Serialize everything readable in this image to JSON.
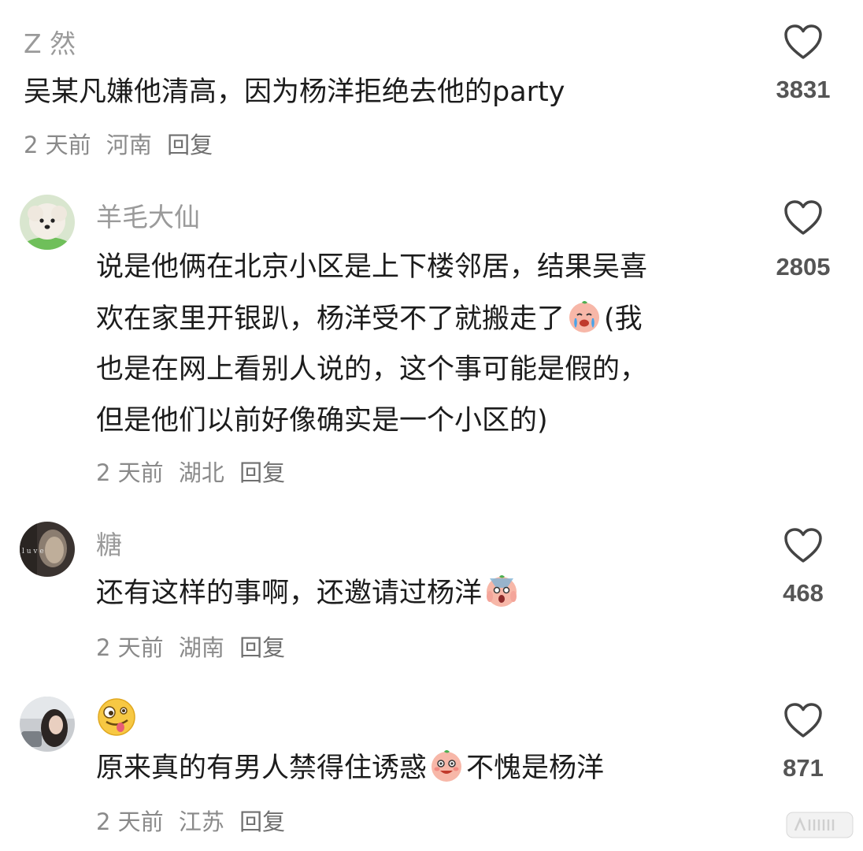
{
  "comments": [
    {
      "author": "Z 然",
      "text": "吴某凡嫌他清高，因为杨洋拒绝去他的party",
      "time": "2 天前",
      "location": "河南",
      "reply": "回复",
      "likes": "3831"
    },
    {
      "author": "羊毛大仙",
      "lines": [
        "说是他俩在北京小区是上下楼邻居，结果吴喜",
        "欢在家里开银趴，杨洋受不了就搬走了",
        "(我",
        "也是在网上看别人说的，这个事可能是假的，",
        "但是他们以前好像确实是一个小区的)"
      ],
      "time": "2 天前",
      "location": "湖北",
      "reply": "回复",
      "likes": "2805",
      "avatar": "white-dog-avatar"
    },
    {
      "author": "糖",
      "text": "还有这样的事啊，还邀请过杨洋",
      "time": "2 天前",
      "location": "湖南",
      "reply": "回复",
      "likes": "468",
      "avatar": "dark-portrait-avatar"
    },
    {
      "author": "crazy-face-emoji",
      "text_before": "原来真的有男人禁得住诱惑",
      "text_after": "不愧是杨洋",
      "time": "2 天前",
      "location": "江苏",
      "reply": "回复",
      "likes": "871",
      "avatar": "girl-in-car-avatar"
    }
  ],
  "colors": {
    "author": "#9a9a9a",
    "text": "#1c1c1c",
    "meta": "#8a8a8a",
    "heart_outline": "#444444"
  }
}
